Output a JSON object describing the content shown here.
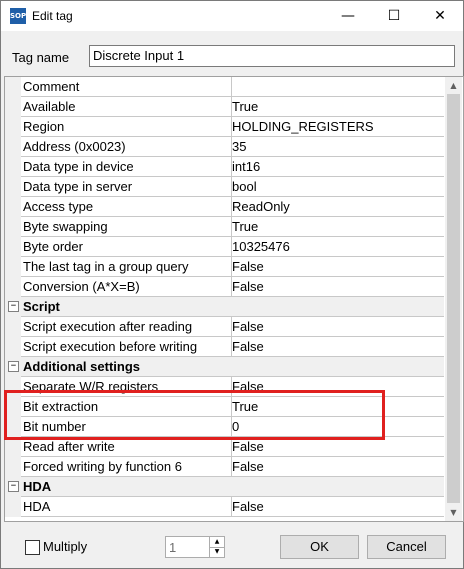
{
  "window": {
    "title": "Edit tag",
    "icon_text": "SOPC",
    "controls": {
      "minimize": "—",
      "maximize": "☐",
      "close": "✕"
    }
  },
  "tag_name": {
    "label": "Tag name",
    "value": "Discrete Input 1"
  },
  "grid": {
    "rows": [
      {
        "name": "Comment",
        "value": ""
      },
      {
        "name": "Available",
        "value": "True"
      },
      {
        "name": "Region",
        "value": "HOLDING_REGISTERS"
      },
      {
        "name": "Address     (0x0023)",
        "value": "35"
      },
      {
        "name": "Data type in device",
        "value": "int16"
      },
      {
        "name": "Data type in server",
        "value": "bool"
      },
      {
        "name": "Access type",
        "value": "ReadOnly"
      },
      {
        "name": "Byte swapping",
        "value": "True"
      },
      {
        "name": "Byte order",
        "value": "10325476"
      },
      {
        "name": "The last tag in a group query",
        "value": "False"
      },
      {
        "name": "Conversion (A*X=B)",
        "value": "False"
      },
      {
        "category": true,
        "name": "Script",
        "toggle": "−"
      },
      {
        "name": "Script execution after reading",
        "value": "False"
      },
      {
        "name": "Script execution before writing",
        "value": "False"
      },
      {
        "category": true,
        "name": "Additional settings",
        "toggle": "−"
      },
      {
        "name": "Separate W/R registers",
        "value": "False"
      },
      {
        "name": "Bit extraction",
        "value": "True"
      },
      {
        "name": "Bit number",
        "value": "0"
      },
      {
        "name": "Read after write",
        "value": "False"
      },
      {
        "name": "Forced writing by function 6",
        "value": "False"
      },
      {
        "category": true,
        "name": "HDA",
        "toggle": "−"
      },
      {
        "name": "HDA",
        "value": "False"
      }
    ]
  },
  "scrollbar": {
    "up": "▲",
    "down": "▼"
  },
  "multiply": {
    "label": "Multiply",
    "checked": false,
    "value": "1",
    "up": "▲",
    "down": "▼"
  },
  "buttons": {
    "ok": "OK",
    "cancel": "Cancel"
  },
  "colors": {
    "highlight": "#e0201f"
  }
}
